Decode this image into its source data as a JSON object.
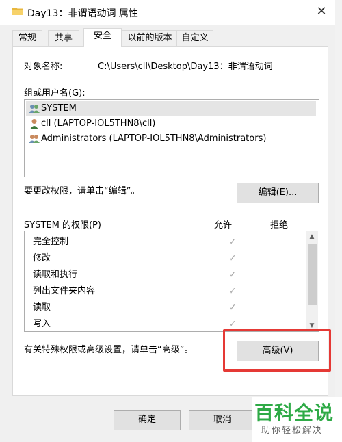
{
  "window": {
    "title": "Day13：非谓语动词 属性",
    "close_glyph": "✕"
  },
  "tabs": [
    {
      "label": "常规",
      "active": false
    },
    {
      "label": "共享",
      "active": false
    },
    {
      "label": "安全",
      "active": true
    },
    {
      "label": "以前的版本",
      "active": false
    },
    {
      "label": "自定义",
      "active": false
    }
  ],
  "security": {
    "object_label": "对象名称:",
    "object_path": "C:\\Users\\cll\\Desktop\\Day13：非谓语动词",
    "group_label": "组或用户名(G):",
    "users": [
      {
        "name": "SYSTEM",
        "icon": "users-group-icon",
        "selected": true
      },
      {
        "name": "cll (LAPTOP-IOL5THN8\\cll)",
        "icon": "user-icon",
        "selected": false
      },
      {
        "name": "Administrators (LAPTOP-IOL5THN8\\Administrators)",
        "icon": "users-group-icon",
        "selected": false
      }
    ],
    "edit_hint": "要更改权限，请单击“编辑”。",
    "edit_button": "编辑(E)...",
    "perm_label": "SYSTEM 的权限(P)",
    "allow_header": "允许",
    "deny_header": "拒绝",
    "permissions": [
      {
        "name": "完全控制",
        "allow": true,
        "deny": false
      },
      {
        "name": "修改",
        "allow": true,
        "deny": false
      },
      {
        "name": "读取和执行",
        "allow": true,
        "deny": false
      },
      {
        "name": "列出文件夹内容",
        "allow": true,
        "deny": false
      },
      {
        "name": "读取",
        "allow": true,
        "deny": false
      },
      {
        "name": "写入",
        "allow": true,
        "deny": false
      }
    ],
    "check_glyph": "✓",
    "advanced_hint": "有关特殊权限或高级设置，请单击“高级”。",
    "advanced_button": "高级(V)"
  },
  "footer": {
    "ok_button": "确定",
    "cancel_button": "取消"
  },
  "watermark": {
    "main": "百科全说",
    "sub": "助你轻松解决"
  },
  "colors": {
    "highlight_box": "#e53935",
    "watermark_green": "#2eaa46"
  }
}
